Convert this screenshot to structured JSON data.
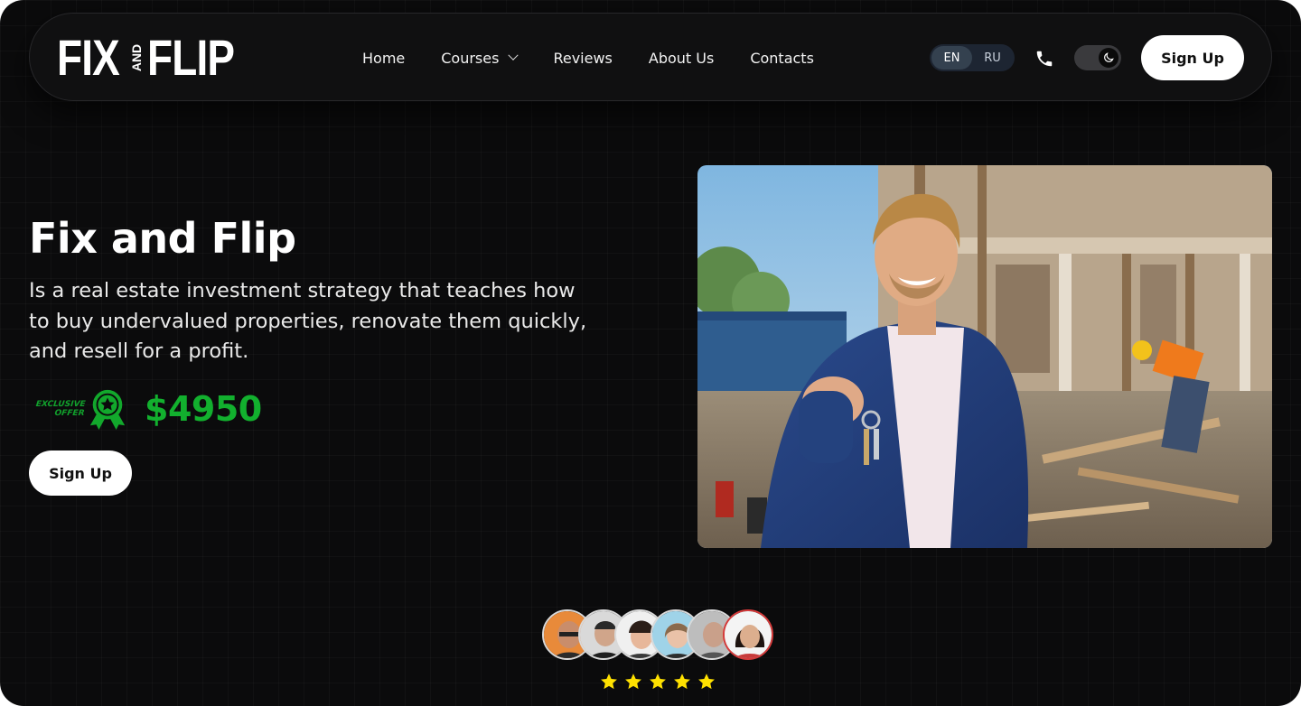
{
  "logo": {
    "left": "FIX",
    "mini_top": "AND",
    "right": "FLIP"
  },
  "nav": {
    "items": [
      {
        "label": "Home"
      },
      {
        "label": "Courses"
      },
      {
        "label": "Reviews"
      },
      {
        "label": "About Us"
      },
      {
        "label": "Contacts"
      }
    ],
    "languages": [
      "EN",
      "RU"
    ],
    "active_language": "EN",
    "icons": {
      "phone": "phone-icon",
      "theme": "moon-icon"
    },
    "signup_label": "Sign Up"
  },
  "hero": {
    "title": "Fix and Flip",
    "description": "Is a real estate investment strategy that teaches how to buy undervalued properties, renovate them quickly, and resell for a profit.",
    "offer_line1": "EXCLUSIVE",
    "offer_line2": "OFFER",
    "price": "$4950",
    "signup_label": "Sign Up",
    "icons": {
      "offer": "award-ribbon-icon"
    }
  },
  "colors": {
    "background": "#0b0b0c",
    "accent_green": "#12b02e",
    "star_yellow": "#ffe100",
    "button_bg": "#ffffff"
  },
  "reviews": {
    "avatar_count": 6,
    "rating": 5,
    "rating_max": 5
  }
}
